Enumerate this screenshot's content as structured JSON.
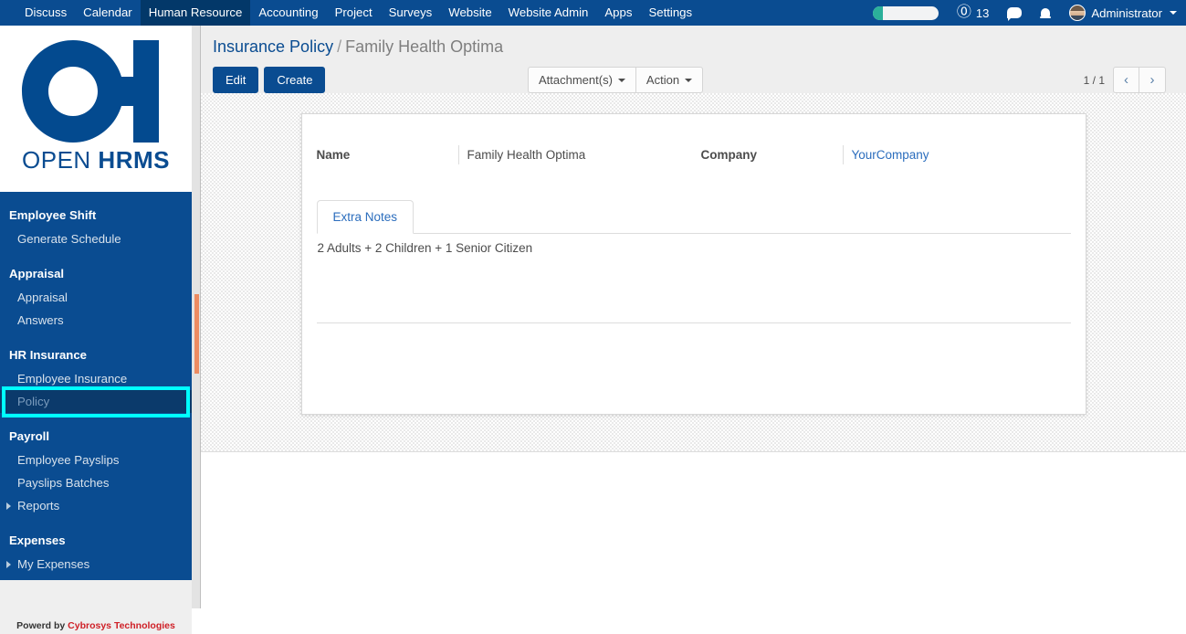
{
  "navbar": {
    "menu_items": [
      {
        "label": "Discuss",
        "active": false
      },
      {
        "label": "Calendar",
        "active": false
      },
      {
        "label": "Human Resource",
        "active": true
      },
      {
        "label": "Accounting",
        "active": false
      },
      {
        "label": "Project",
        "active": false
      },
      {
        "label": "Surveys",
        "active": false
      },
      {
        "label": "Website",
        "active": false
      },
      {
        "label": "Website Admin",
        "active": false
      },
      {
        "label": "Apps",
        "active": false
      },
      {
        "label": "Settings",
        "active": false
      }
    ],
    "mentions_icon": "at-sign-icon",
    "mentions_count": "13",
    "messages_icon": "chat-bubble-icon",
    "notifications_icon": "bell-icon",
    "user_name": "Administrator",
    "avatar_icon": "user-avatar",
    "progress_widget": "systray-progress-bar"
  },
  "sidebar": {
    "logo_icon": "open-hrms-key-logo",
    "logo_text_thin": "OPEN",
    "logo_text_bold": "HRMS",
    "brand_color": "#0a4c91",
    "groups": [
      {
        "title": "Employee Shift",
        "items": [
          {
            "label": "Generate Schedule",
            "caret": false,
            "active": false
          }
        ]
      },
      {
        "title": "Appraisal",
        "items": [
          {
            "label": "Appraisal",
            "caret": false,
            "active": false
          },
          {
            "label": "Answers",
            "caret": false,
            "active": false
          }
        ]
      },
      {
        "title": "HR Insurance",
        "items": [
          {
            "label": "Employee Insurance",
            "caret": false,
            "active": false
          },
          {
            "label": "Policy",
            "caret": false,
            "active": true
          }
        ]
      },
      {
        "title": "Payroll",
        "items": [
          {
            "label": "Employee Payslips",
            "caret": false,
            "active": false
          },
          {
            "label": "Payslips Batches",
            "caret": false,
            "active": false
          },
          {
            "label": "Reports",
            "caret": true,
            "active": false
          }
        ]
      },
      {
        "title": "Expenses",
        "items": [
          {
            "label": "My Expenses",
            "caret": true,
            "active": false
          }
        ]
      }
    ],
    "footer_prefix": "Powerd by ",
    "footer_brand": "Cybrosys Technologies",
    "highlight_color": "#00ffff",
    "highlight_target": "Policy"
  },
  "control_panel": {
    "breadcrumb_root": "Insurance Policy",
    "breadcrumb_sep": "/",
    "breadcrumb_current": "Family Health Optima",
    "edit_label": "Edit",
    "create_label": "Create",
    "attachments_label": "Attachment(s)",
    "action_label": "Action",
    "pager_text": "1 / 1",
    "prev_icon": "chevron-left-icon",
    "next_icon": "chevron-right-icon"
  },
  "form": {
    "name_label": "Name",
    "name_value": "Family Health Optima",
    "company_label": "Company",
    "company_value": "YourCompany",
    "tab_label": "Extra Notes",
    "notes_value": "2 Adults + 2 Children + 1 Senior Citizen"
  }
}
